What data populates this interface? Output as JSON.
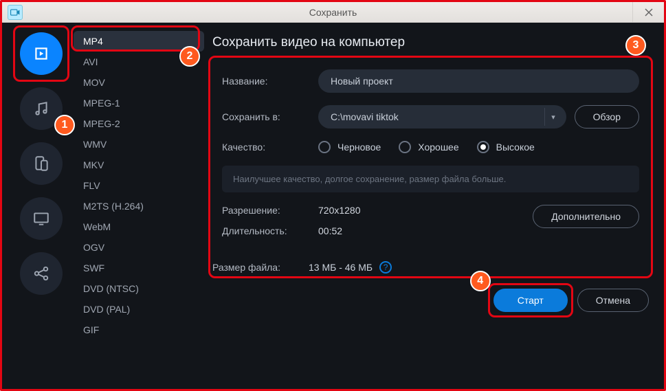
{
  "window": {
    "title": "Сохранить"
  },
  "rail": {
    "items": [
      "video",
      "audio",
      "devices",
      "tv",
      "share"
    ],
    "active": 0
  },
  "formats": [
    "MP4",
    "AVI",
    "MOV",
    "MPEG-1",
    "MPEG-2",
    "WMV",
    "MKV",
    "FLV",
    "M2TS (H.264)",
    "WebM",
    "OGV",
    "SWF",
    "DVD (NTSC)",
    "DVD (PAL)",
    "GIF"
  ],
  "formats_active": 0,
  "panel": {
    "title": "Сохранить видео на компьютер",
    "name_label": "Название:",
    "name_value": "Новый проект",
    "saveto_label": "Сохранить в:",
    "saveto_value": "C:\\movavi tiktok",
    "browse_label": "Обзор",
    "quality_label": "Качество:",
    "quality_options": [
      "Черновое",
      "Хорошее",
      "Высокое"
    ],
    "quality_selected": 2,
    "hint": "Наилучшее качество, долгое сохранение, размер файла больше.",
    "resolution_label": "Разрешение:",
    "resolution_value": "720x1280",
    "duration_label": "Длительность:",
    "duration_value": "00:52",
    "advanced_label": "Дополнительно",
    "filesize_label": "Размер файла:",
    "filesize_value": "13 МБ - 46 МБ",
    "start_label": "Старт",
    "cancel_label": "Отмена"
  },
  "annotations": {
    "b1": "1",
    "b2": "2",
    "b3": "3",
    "b4": "4"
  }
}
